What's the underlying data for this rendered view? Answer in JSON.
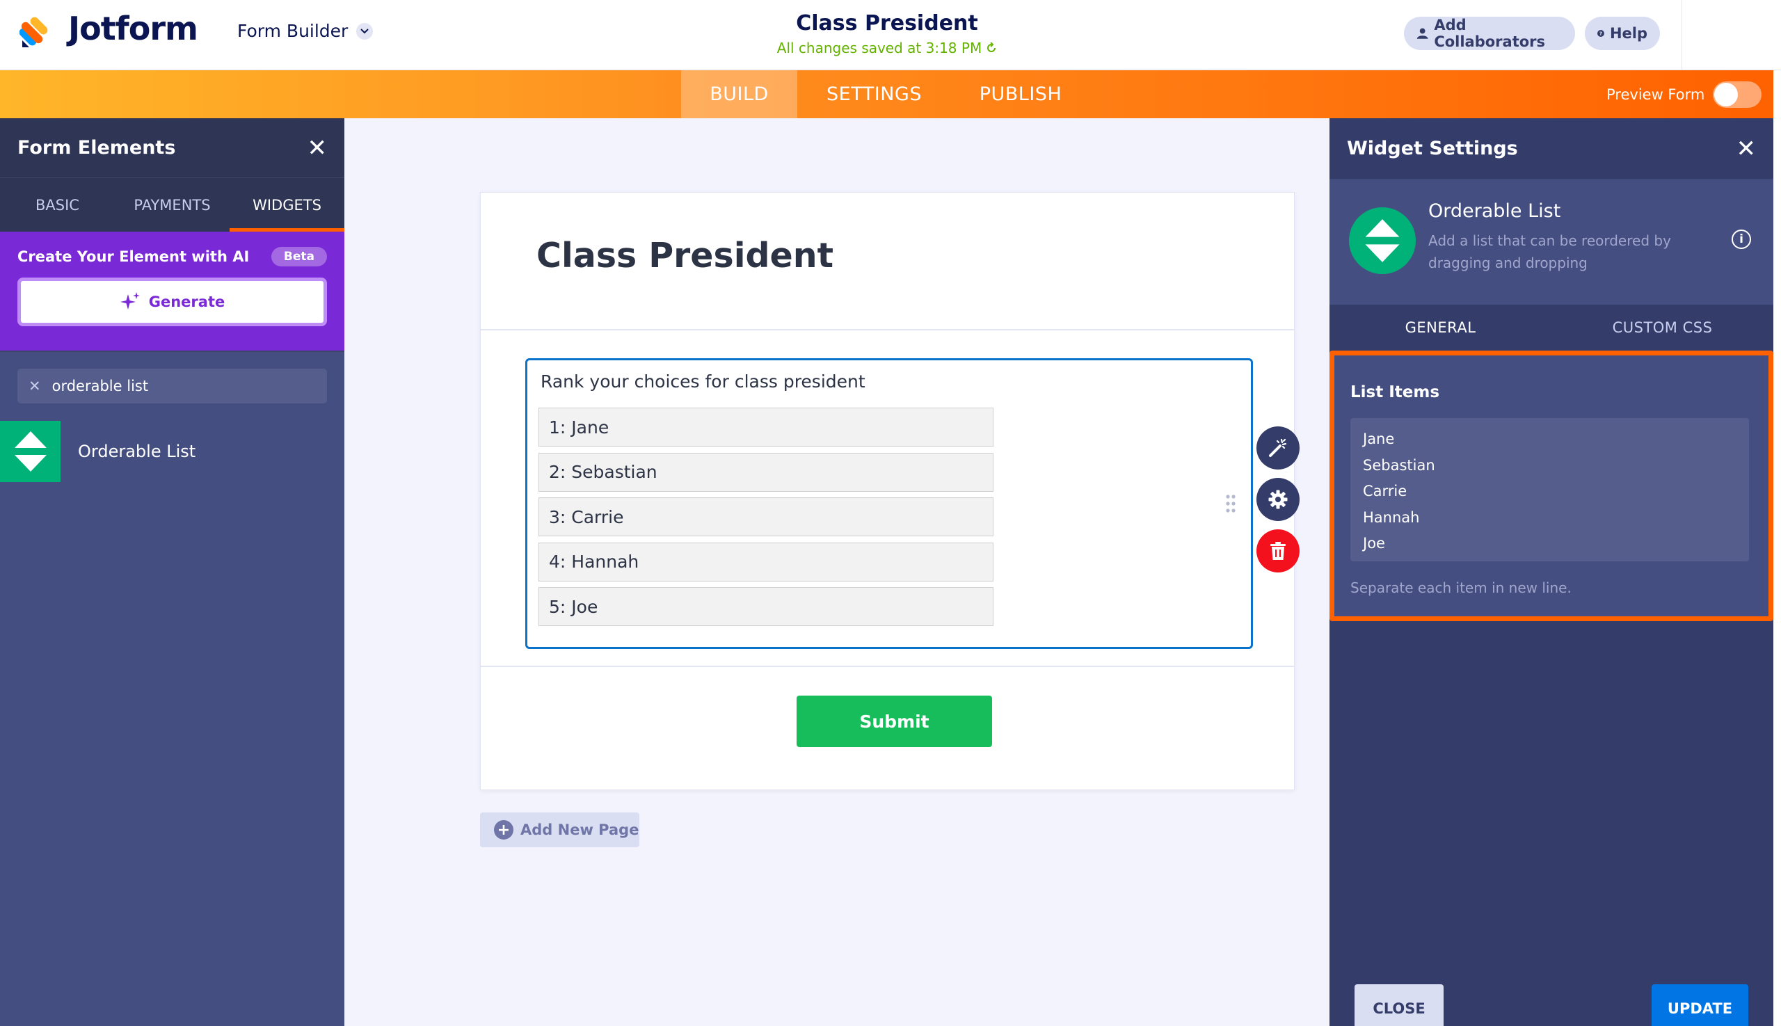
{
  "header": {
    "brand": "Jotform",
    "builder_menu": "Form Builder",
    "form_title": "Class President",
    "save_status": "All changes saved at 3:18 PM",
    "add_collaborators": "Add Collaborators",
    "help": "Help",
    "colors": {
      "brand_navy": "#0a1551",
      "saved_green": "#64b200"
    }
  },
  "nav": {
    "tabs": [
      {
        "label": "BUILD",
        "active": true
      },
      {
        "label": "SETTINGS",
        "active": false
      },
      {
        "label": "PUBLISH",
        "active": false
      }
    ],
    "preview_label": "Preview Form",
    "preview_on": false,
    "colors": {
      "gradient_start": "#ffb629",
      "gradient_end": "#ff6100"
    }
  },
  "left_panel": {
    "title": "Form Elements",
    "tabs": [
      {
        "label": "BASIC",
        "active": false
      },
      {
        "label": "PAYMENTS",
        "active": false
      },
      {
        "label": "WIDGETS",
        "active": true
      }
    ],
    "ai": {
      "title": "Create Your Element with AI",
      "badge": "Beta",
      "generate_label": "Generate"
    },
    "search": {
      "value": "orderable list",
      "placeholder": ""
    },
    "results": [
      {
        "label": "Orderable List",
        "icon": "orderable-list-icon"
      }
    ]
  },
  "form": {
    "heading": "Class President",
    "question": "Rank your choices for class president",
    "items": [
      "1: Jane",
      "2: Sebastian",
      "3: Carrie",
      "4: Hannah",
      "5: Joe"
    ],
    "submit_label": "Submit",
    "add_page_label": "Add New Page",
    "tools": [
      "magic-wand-icon",
      "gear-icon",
      "trash-icon"
    ]
  },
  "right_panel": {
    "title": "Widget Settings",
    "widget_name": "Orderable List",
    "widget_desc": "Add a list that can be reordered by dragging and dropping",
    "tabs": [
      {
        "label": "GENERAL",
        "active": true
      },
      {
        "label": "CUSTOM CSS",
        "active": false
      }
    ],
    "list_items_title": "List Items",
    "list_items": [
      "Jane",
      "Sebastian",
      "Carrie",
      "Hannah",
      "Joe"
    ],
    "hint": "Separate each item in new line.",
    "close_label": "CLOSE",
    "update_label": "UPDATE",
    "colors": {
      "highlight": "#ff6100",
      "update_blue": "#0075e3"
    }
  }
}
